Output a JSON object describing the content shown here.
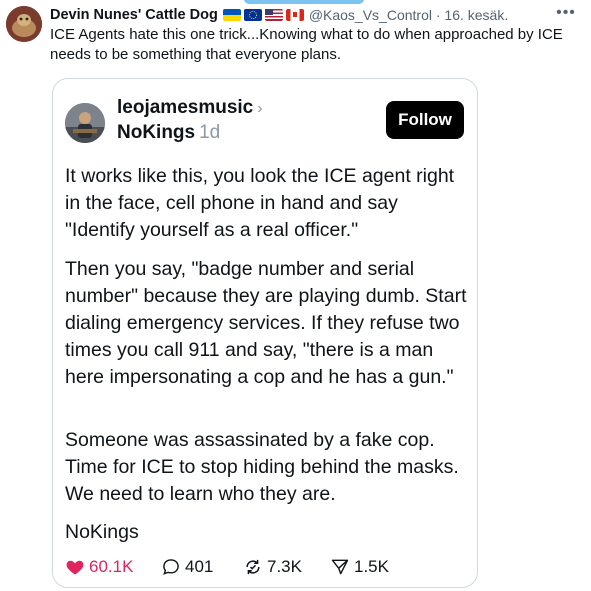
{
  "tweet": {
    "display_name": "Devin Nunes' Cattle Dog",
    "handle": "@Kaos_Vs_Control",
    "date": "16. kesäk.",
    "handle_line": "@Kaos_Vs_Control · 16. kesäk.",
    "text": "ICE Agents hate this one trick...Knowing what to do when approached by ICE needs to be something that everyone plans."
  },
  "embed": {
    "username": "leojamesmusic",
    "subline_name": "NoKings",
    "time": "1d",
    "follow_label": "Follow",
    "paragraphs": [
      "It works like this, you look the ICE agent right in the face, cell phone in hand and say \"Identify yourself as a real officer.\"",
      "Then you say, \"badge number and serial number\" because they are playing dumb. Start dialing emergency services. If they refuse two times you call 911 and say, \"there is a man here impersonating a cop and he has a gun.\"",
      "Someone was assassinated by a fake cop. Time for ICE to stop hiding behind the masks. We need to learn who they are.",
      "NoKings"
    ],
    "stats": {
      "likes": "60.1K",
      "replies": "401",
      "reposts": "7.3K",
      "shares": "1.5K"
    }
  },
  "colors": {
    "like": "#e0245e",
    "muted": "#536471",
    "follow_bg": "#000000"
  },
  "icons": [
    "more-icon",
    "heart-icon",
    "reply-icon",
    "repost-icon",
    "share-icon",
    "chevron-right-icon"
  ]
}
